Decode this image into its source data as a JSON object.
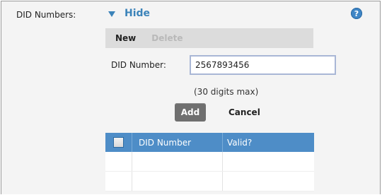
{
  "field": {
    "label": "DID Numbers:"
  },
  "toggle": {
    "label": "Hide"
  },
  "help": {
    "glyph": "?"
  },
  "toolbar": {
    "new_label": "New",
    "delete_label": "Delete"
  },
  "form": {
    "did_label": "DID Number:",
    "did_value": "2567893456",
    "hint": "(30 digits max)",
    "add_label": "Add",
    "cancel_label": "Cancel"
  },
  "grid": {
    "columns": [
      "DID Number",
      "Valid?"
    ],
    "rows": [
      [
        "",
        ""
      ],
      [
        "",
        ""
      ]
    ]
  },
  "colors": {
    "accent": "#3b83b9",
    "header": "#4e8dc7",
    "add_button": "#6f6f6f"
  }
}
